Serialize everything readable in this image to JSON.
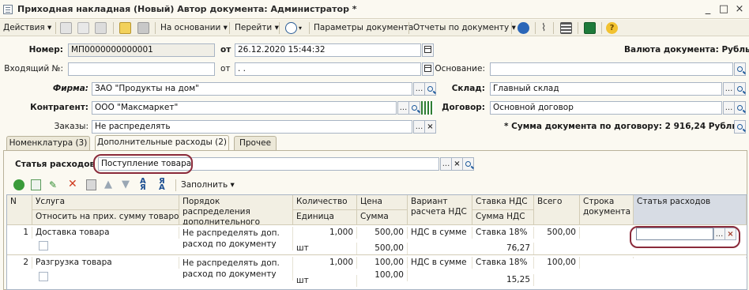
{
  "window": {
    "title": "Приходная накладная (Новый)  Автор документа: Администратор *",
    "minimize": "_",
    "maximize": "□",
    "close": "×"
  },
  "toolbar": {
    "actions": "Действия ▾",
    "based_on": "На основании ▾",
    "go_to": "Перейти ▾",
    "params": "Параметры документа",
    "reports": "Отчеты по документу ▾"
  },
  "header": {
    "number_label": "Номер:",
    "number_value": "МП0000000000001",
    "from_label": "от",
    "date_value": "26.12.2020 15:44:32",
    "currency_text": "Валюта документа: Рубль",
    "incoming_label": "Входящий №:",
    "incoming_value": "",
    "incoming_from_label": "от",
    "incoming_date_value": " .  .",
    "basis_label": "Основание:",
    "basis_value": "",
    "firm_label": "Фирма:",
    "firm_value": "ЗАО \"Продукты на дом\"",
    "warehouse_label": "Склад:",
    "warehouse_value": "Главный склад",
    "contractor_label": "Контрагент:",
    "contractor_value": "ООО \"Максмаркет\"",
    "contract_label": "Договор:",
    "contract_value": "Основной договор",
    "orders_label": "Заказы:",
    "orders_value": "Не распределять",
    "sum_text": "* Сумма документа по договору: 2 916,24 Рубль"
  },
  "tabs": [
    {
      "label": "Номенклатура (3)"
    },
    {
      "label": "Дополнительные расходы (2)"
    },
    {
      "label": "Прочее"
    }
  ],
  "expense": {
    "label": "Статья расходов",
    "value": "Поступление товара"
  },
  "grid_toolbar": {
    "fill": "Заполнить ▾"
  },
  "grid": {
    "headers": {
      "n": "N",
      "service": "Услуга",
      "relate": "Относить на  прих. сумму товаров",
      "order": "Порядок распределения дополнительного расхода",
      "qty": "Количество",
      "unit": "Единица",
      "price": "Цена",
      "sum": "Сумма",
      "vat_var": "Вариант расчета НДС",
      "vat_rate": "Ставка НДС",
      "vat_sum": "Сумма НДС",
      "total": "Всего",
      "doc_row": "Строка документа",
      "expense_item": "Статья расходов"
    },
    "rows": [
      {
        "n": "1",
        "service": "Доставка товара",
        "order": "Не распределять доп. расход по документу",
        "qty": "1,000",
        "unit": "шт",
        "price": "500,00",
        "sum": "500,00",
        "vat_var": "НДС в сумме",
        "vat_rate": "Ставка 18%",
        "vat_sum": "76,27",
        "total": "500,00",
        "doc_row": "",
        "expense_item": ""
      },
      {
        "n": "2",
        "service": "Разгрузка товара",
        "order": "Не распределять доп. расход по документу",
        "qty": "1,000",
        "unit": "шт",
        "price": "100,00",
        "sum": "100,00",
        "vat_var": "НДС в сумме",
        "vat_rate": "Ставка 18%",
        "vat_sum": "15,25",
        "total": "100,00",
        "doc_row": "",
        "expense_item": ""
      }
    ]
  },
  "colors": {
    "accent": "#8a2a3a",
    "header_bg": "#f2efe3",
    "field_border": "#a8b4c4"
  }
}
